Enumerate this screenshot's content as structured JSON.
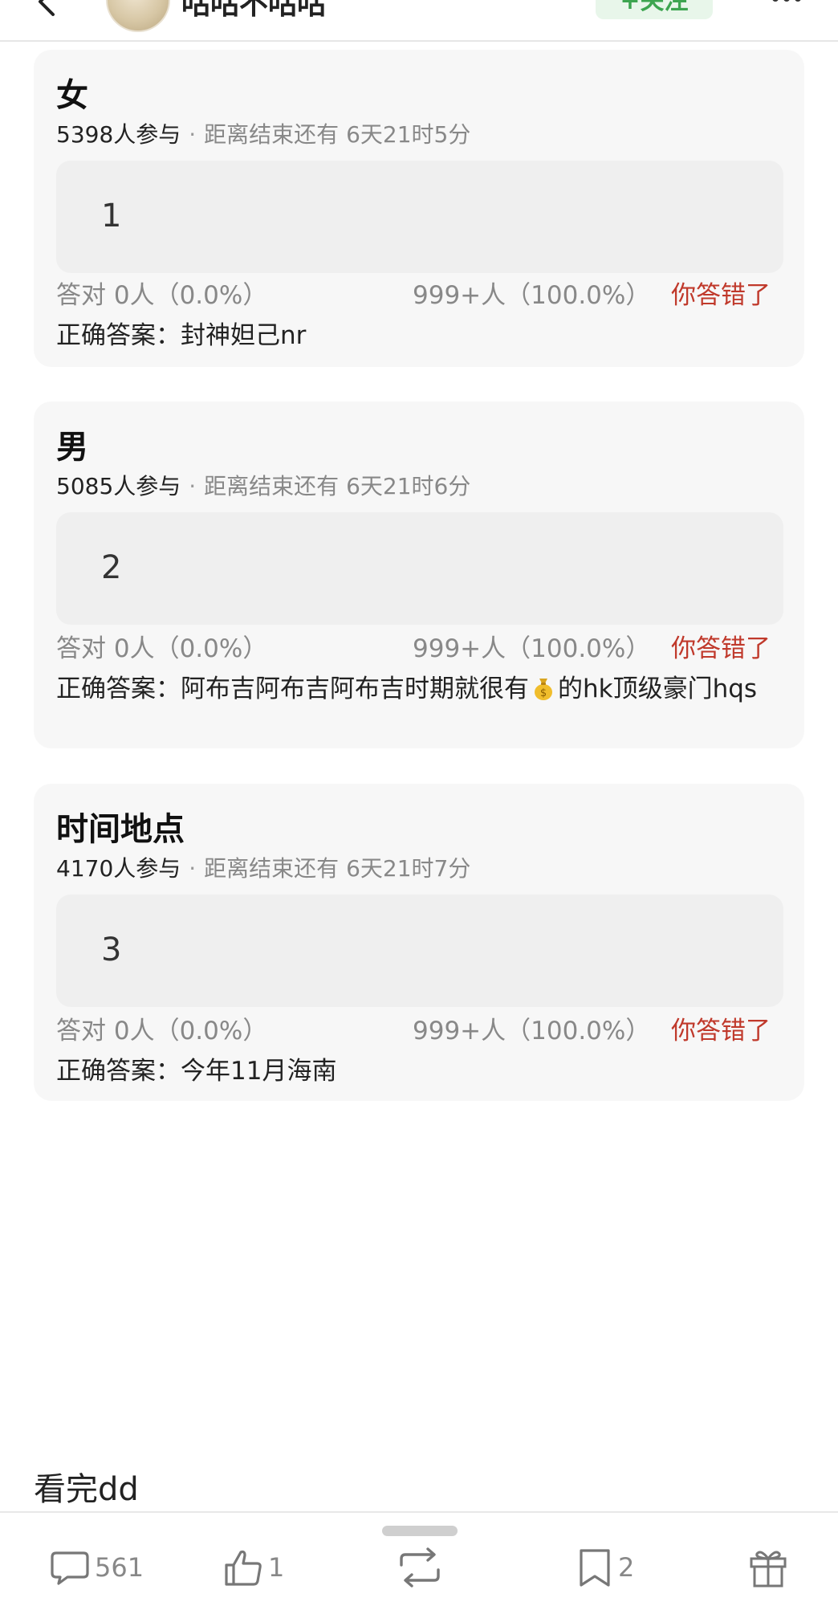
{
  "header": {
    "author_name": "咕咕不咕咕",
    "follow_label": "+关注"
  },
  "quizzes": [
    {
      "title": "女",
      "participants": "5398人参与",
      "separator": "·",
      "deadline": "距离结束还有 6天21时5分",
      "my_answer": "1",
      "correct_stat": "答对  0人（0.0%）",
      "wrong_stat": "999+人（100.0%）",
      "result_tag": "你答错了",
      "correct_answer": "正确答案：封神妲己nr"
    },
    {
      "title": "男",
      "participants": "5085人参与",
      "separator": "·",
      "deadline": "距离结束还有 6天21时6分",
      "my_answer": "2",
      "correct_stat": "答对  0人（0.0%）",
      "wrong_stat": "999+人（100.0%）",
      "result_tag": "你答错了",
      "correct_answer_prefix": "正确答案：阿布吉阿布吉阿布吉时期就很有",
      "correct_answer_suffix": "的hk顶级豪门hqs",
      "inline_icon": "money-bag-emoji"
    },
    {
      "title": "时间地点",
      "participants": "4170人参与",
      "separator": "·",
      "deadline": "距离结束还有 6天21时7分",
      "my_answer": "3",
      "correct_stat": "答对  0人（0.0%）",
      "wrong_stat": "999+人（100.0%）",
      "result_tag": "你答错了",
      "correct_answer": "正确答案：今年11月海南"
    }
  ],
  "post": {
    "text": "看完dd"
  },
  "actions": {
    "comments": "561",
    "likes": "1",
    "repost": "",
    "favorites": "2",
    "icons": [
      "comment-icon",
      "like-icon",
      "repost-icon",
      "bookmark-icon",
      "gift-icon"
    ]
  },
  "colors": {
    "wrong": "#c0392b",
    "follow_green": "#3da550",
    "card_bg": "#f7f7f7",
    "answer_bg": "#efefef"
  }
}
